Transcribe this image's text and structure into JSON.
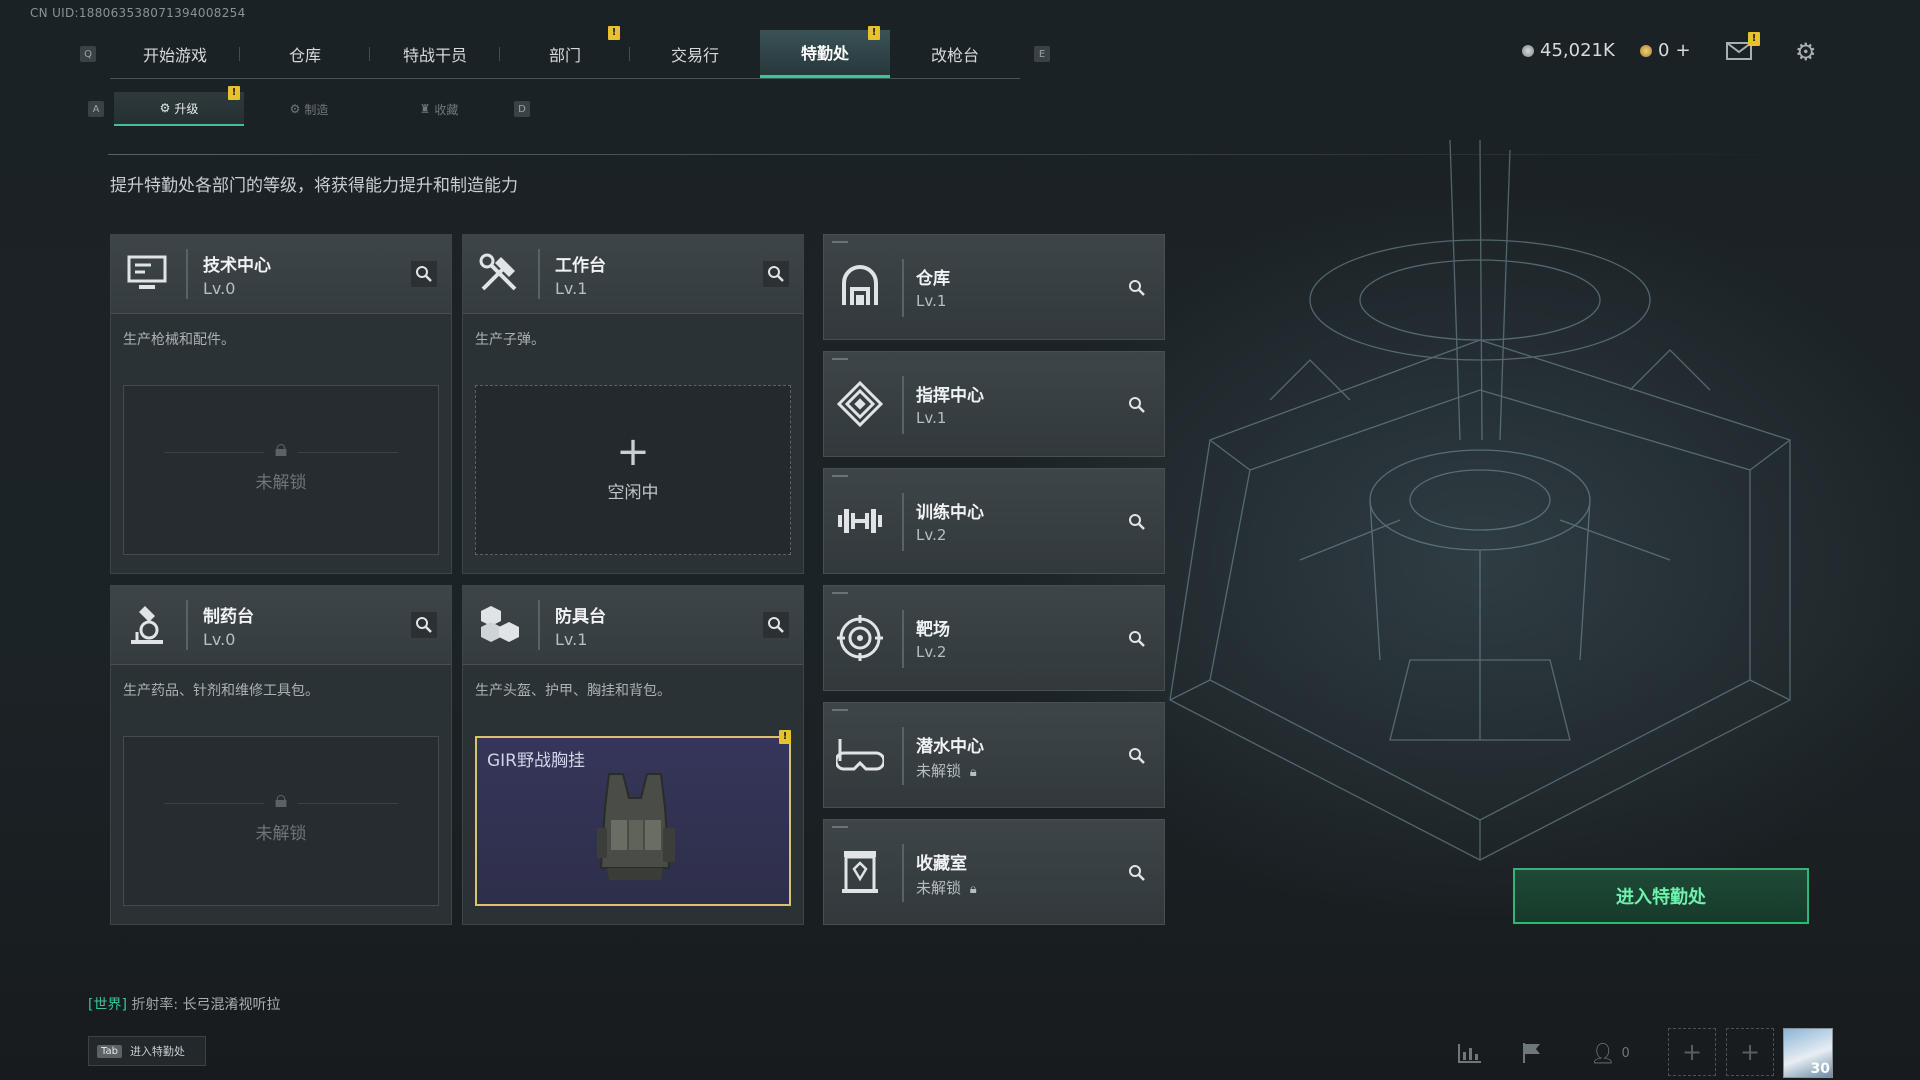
{
  "uid": "CN UID:18806353807139400825​4",
  "nav": {
    "key_left": "Q",
    "key_right": "E",
    "tabs": [
      {
        "label": "开始游戏"
      },
      {
        "label": "仓库"
      },
      {
        "label": "特战干员"
      },
      {
        "label": "部门"
      },
      {
        "label": "交易行"
      },
      {
        "label": "特勤处",
        "active": true
      },
      {
        "label": "改枪台"
      }
    ],
    "alert_mark": "!"
  },
  "currency": {
    "coins": "45,021K",
    "gold": "0",
    "gold_plus": "+"
  },
  "subnav": {
    "key_left": "A",
    "key_right": "D",
    "tabs": [
      {
        "label": "升级",
        "active": true
      },
      {
        "label": "制造"
      },
      {
        "label": "收藏"
      }
    ]
  },
  "description": "提升特勤处各部门的等级，将获得能力提升和制造能力",
  "stations": [
    {
      "title": "技术中心",
      "level": "Lv.0",
      "desc": "生产枪械和配件。",
      "slot_state": "locked",
      "slot_label": "未解锁"
    },
    {
      "title": "工作台",
      "level": "Lv.1",
      "desc": "生产子弹。",
      "slot_state": "idle",
      "slot_label": "空闲中"
    },
    {
      "title": "制药台",
      "level": "Lv.0",
      "desc": "生产药品、针剂和维修工具包。",
      "slot_state": "locked",
      "slot_label": "未解锁"
    },
    {
      "title": "防具台",
      "level": "Lv.1",
      "desc": "生产头盔、护甲、胸挂和背包。",
      "slot_state": "item",
      "slot_label": "GIR野战胸挂"
    }
  ],
  "facilities": [
    {
      "title": "仓库",
      "level": "Lv.1",
      "icon": "vault-icon"
    },
    {
      "title": "指挥中心",
      "level": "Lv.1",
      "icon": "command-icon"
    },
    {
      "title": "训练中心",
      "level": "Lv.2",
      "icon": "dumbbell-icon"
    },
    {
      "title": "靶场",
      "level": "Lv.2",
      "icon": "target-icon"
    },
    {
      "title": "潜水中心",
      "level": "未解锁",
      "icon": "diving-mask-icon",
      "locked": true
    },
    {
      "title": "收藏室",
      "level": "未解锁",
      "icon": "collection-icon",
      "locked": true
    }
  ],
  "enter_button": "进入特勤处",
  "chat": {
    "channel": "[世界]",
    "name": "折射率:",
    "message": "长弓混淆视听拉"
  },
  "tab_hint": {
    "key": "Tab",
    "label": "进入特勤处"
  },
  "social": {
    "friends_count": "0"
  },
  "avatar_level": "30",
  "colors": {
    "accent": "#3ec29a",
    "alert": "#e8c22e",
    "item_border": "#d8c46a"
  }
}
